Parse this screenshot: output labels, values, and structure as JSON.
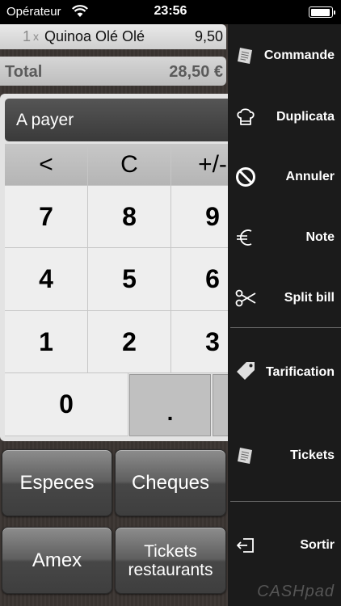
{
  "status_bar": {
    "carrier": "Opérateur",
    "time": "23:56",
    "battery_level_percent": 95
  },
  "ticket": {
    "lines": [
      {
        "qty": "1",
        "x": "x",
        "name": "Quinoa Olé Olé",
        "price": "9,50"
      }
    ],
    "total_label": "Total",
    "total_value": "28,50 €"
  },
  "payment_display": {
    "label": "A payer"
  },
  "keypad": {
    "top_row": [
      "<",
      "C",
      "+/-"
    ],
    "rows": [
      [
        "7",
        "8",
        "9"
      ],
      [
        "4",
        "5",
        "6"
      ],
      [
        "1",
        "2",
        "3"
      ]
    ],
    "zero": "0",
    "dot": "."
  },
  "payment_methods": [
    {
      "label": "Especes"
    },
    {
      "label": "Cheques"
    },
    {
      "label": "Amex"
    },
    {
      "label": "Tickets restaurants",
      "label_line1": "Tickets",
      "label_line2": "restaurants"
    }
  ],
  "sidebar": {
    "items": [
      {
        "label": "Commande",
        "icon": "ticket-icon"
      },
      {
        "label": "Duplicata",
        "icon": "chef-hat-icon"
      },
      {
        "label": "Annuler",
        "icon": "prohibited-icon"
      },
      {
        "label": "Note",
        "icon": "euro-icon"
      },
      {
        "label": "Split bill",
        "icon": "scissors-icon"
      },
      {
        "label": "Tarification",
        "icon": "price-tag-icon"
      },
      {
        "label": "Tickets",
        "icon": "ticket-icon"
      },
      {
        "label": "Sortir",
        "icon": "exit-icon"
      }
    ],
    "brand": "CASHpad"
  },
  "colors": {
    "sidebar_bg": "#1b1b1b",
    "payment_display_bg": "#444444",
    "key_bg": "#eeeeee"
  }
}
